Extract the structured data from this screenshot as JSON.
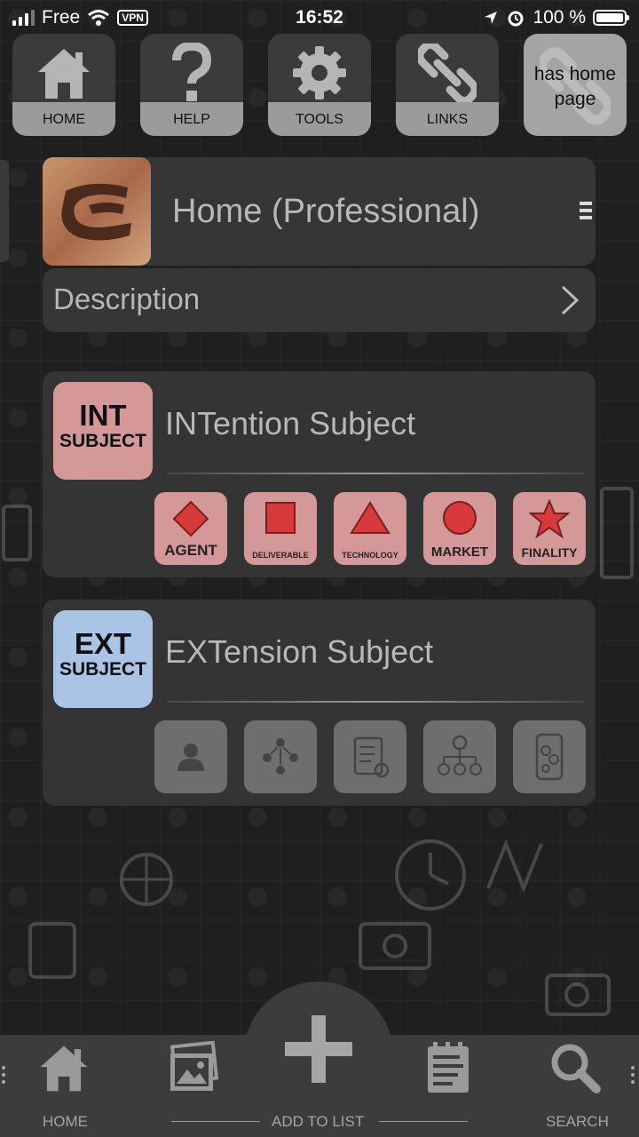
{
  "status_bar": {
    "carrier": "Free",
    "vpn": "VPN",
    "time": "16:52",
    "battery": "100 %"
  },
  "toolbar": {
    "home": "HOME",
    "help": "HELP",
    "tools": "TOOLS",
    "links": "LINKS",
    "home_page_note": "has home page"
  },
  "header": {
    "title": "Home (Professional)",
    "description_label": "Description"
  },
  "intention": {
    "badge_big": "INT",
    "badge_small": "SUBJECT",
    "title": "INTention Subject",
    "tiles": [
      "AGENT",
      "DELIVERABLE",
      "TECHNOLOGY",
      "MARKET",
      "FINALITY"
    ]
  },
  "extension": {
    "badge_big": "EXT",
    "badge_small": "SUBJECT",
    "title": "EXTension Subject"
  },
  "bottom_nav": {
    "home": "HOME",
    "add": "ADD TO LIST",
    "search": "SEARCH"
  },
  "colors": {
    "int_badge": "#d49898",
    "ext_badge": "#a9c4e4",
    "tile_red_shape": "#d63a3a"
  }
}
